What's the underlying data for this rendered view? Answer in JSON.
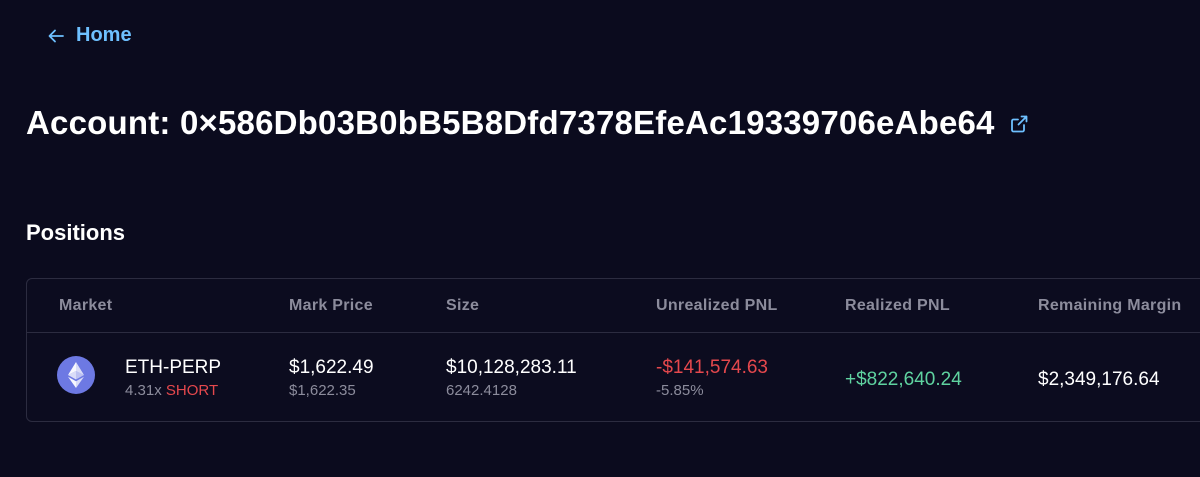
{
  "nav": {
    "back_label": "Home"
  },
  "account": {
    "prefix": "Account: ",
    "address": "0×586Db03B0bB5B8Dfd7378EfeAc19339706eAbe64"
  },
  "positions": {
    "title": "Positions",
    "columns": {
      "market": "Market",
      "mark_price": "Mark Price",
      "size": "Size",
      "unrealized_pnl": "Unrealized PNL",
      "realized_pnl": "Realized PNL",
      "remaining_margin": "Remaining Margin"
    },
    "rows": [
      {
        "market_icon": "ethereum-icon",
        "market": "ETH-PERP",
        "leverage": "4.31x",
        "side": "SHORT",
        "mark_price": "$1,622.49",
        "entry_price": "$1,622.35",
        "size_usd": "$10,128,283.11",
        "size_units": "6242.4128",
        "unrealized_pnl": "-$141,574.63",
        "unrealized_pnl_pct": "-5.85%",
        "realized_pnl": "+$822,640.24",
        "remaining_margin": "$2,349,176.64"
      }
    ]
  },
  "colors": {
    "background": "#0b0b1e",
    "link": "#6ec0ff",
    "negative": "#e5484d",
    "positive": "#5fd3a0",
    "muted": "#8c8c9c",
    "eth_icon": "#6d79e3"
  }
}
